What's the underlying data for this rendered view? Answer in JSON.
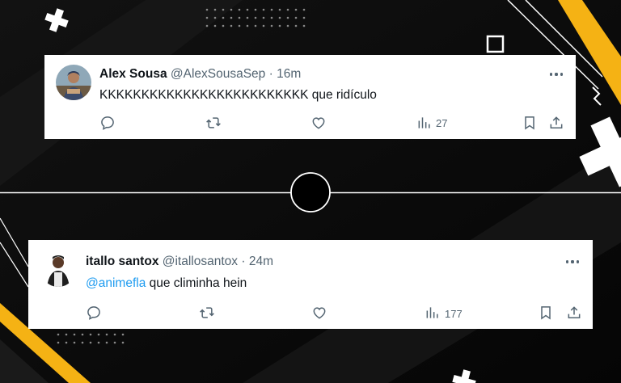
{
  "colors": {
    "background": "#0a0a0a",
    "accent_yellow": "#f5b214",
    "mention_blue": "#1d9bf0",
    "muted_text": "#536471"
  },
  "tweets": [
    {
      "name": "Alex Sousa",
      "handle": "@AlexSousaSep",
      "separator": "·",
      "time": "16m",
      "text": "KKKKKKKKKKKKKKKKKKKKKKKKK que ridículo",
      "views": "27",
      "icons": [
        "reply-icon",
        "retweet-icon",
        "like-icon",
        "views-icon",
        "bookmark-icon",
        "share-icon",
        "more-icon"
      ]
    },
    {
      "name": "itallo santox",
      "handle": "@itallosantox",
      "separator": "·",
      "time": "24m",
      "mention": "@animefla",
      "text": " que climinha hein",
      "views": "177",
      "icons": [
        "reply-icon",
        "retweet-icon",
        "like-icon",
        "views-icon",
        "bookmark-icon",
        "share-icon",
        "more-icon"
      ]
    }
  ]
}
